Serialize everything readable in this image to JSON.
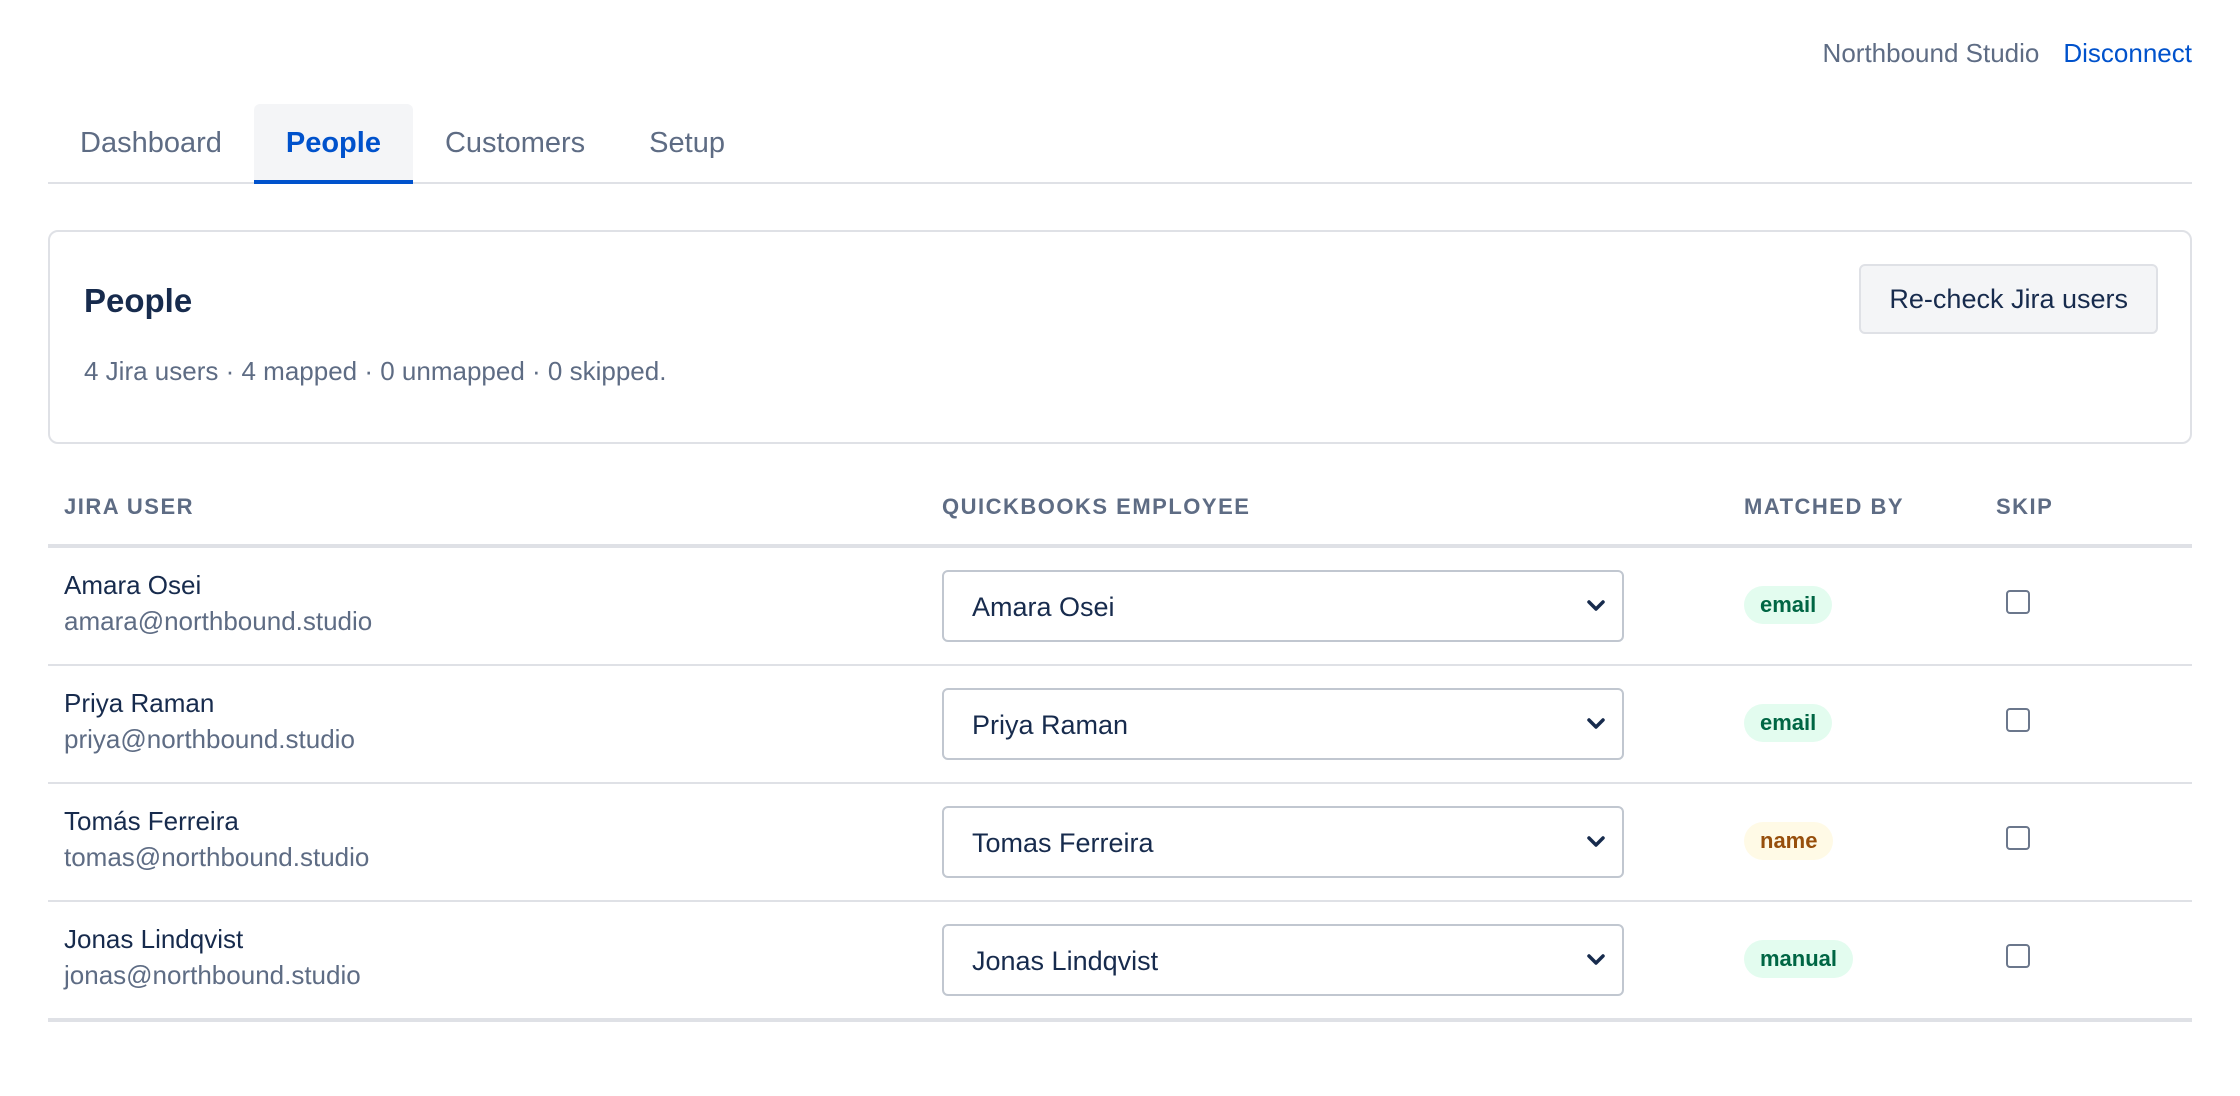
{
  "header": {
    "org_name": "Northbound Studio",
    "disconnect_label": "Disconnect"
  },
  "tabs": [
    {
      "label": "Dashboard",
      "active": false
    },
    {
      "label": "People",
      "active": true
    },
    {
      "label": "Customers",
      "active": false
    },
    {
      "label": "Setup",
      "active": false
    }
  ],
  "summary_card": {
    "title": "People",
    "summary": "4 Jira users · 4 mapped · 0 unmapped · 0 skipped.",
    "recheck_label": "Re-check Jira users"
  },
  "table": {
    "columns": {
      "jira_user": "JIRA USER",
      "quickbooks_employee": "QUICKBOOKS EMPLOYEE",
      "matched_by": "MATCHED BY",
      "skip": "SKIP"
    },
    "rows": [
      {
        "name": "Amara Osei",
        "email": "amara@northbound.studio",
        "employee": "Amara Osei",
        "matched_by": "email",
        "skip": false
      },
      {
        "name": "Priya Raman",
        "email": "priya@northbound.studio",
        "employee": "Priya Raman",
        "matched_by": "email",
        "skip": false
      },
      {
        "name": "Tomás Ferreira",
        "email": "tomas@northbound.studio",
        "employee": "Tomas Ferreira",
        "matched_by": "name",
        "skip": false
      },
      {
        "name": "Jonas Lindqvist",
        "email": "jonas@northbound.studio",
        "employee": "Jonas Lindqvist",
        "matched_by": "manual",
        "skip": false
      }
    ]
  },
  "icons": {
    "select_chevron": "chevron-down-icon"
  },
  "colors": {
    "accent": "#0052cc",
    "badge_green_bg": "#e3fcef",
    "badge_green_text": "#006644",
    "badge_yellow_bg": "#fffae6",
    "badge_yellow_text": "#974f0c"
  }
}
